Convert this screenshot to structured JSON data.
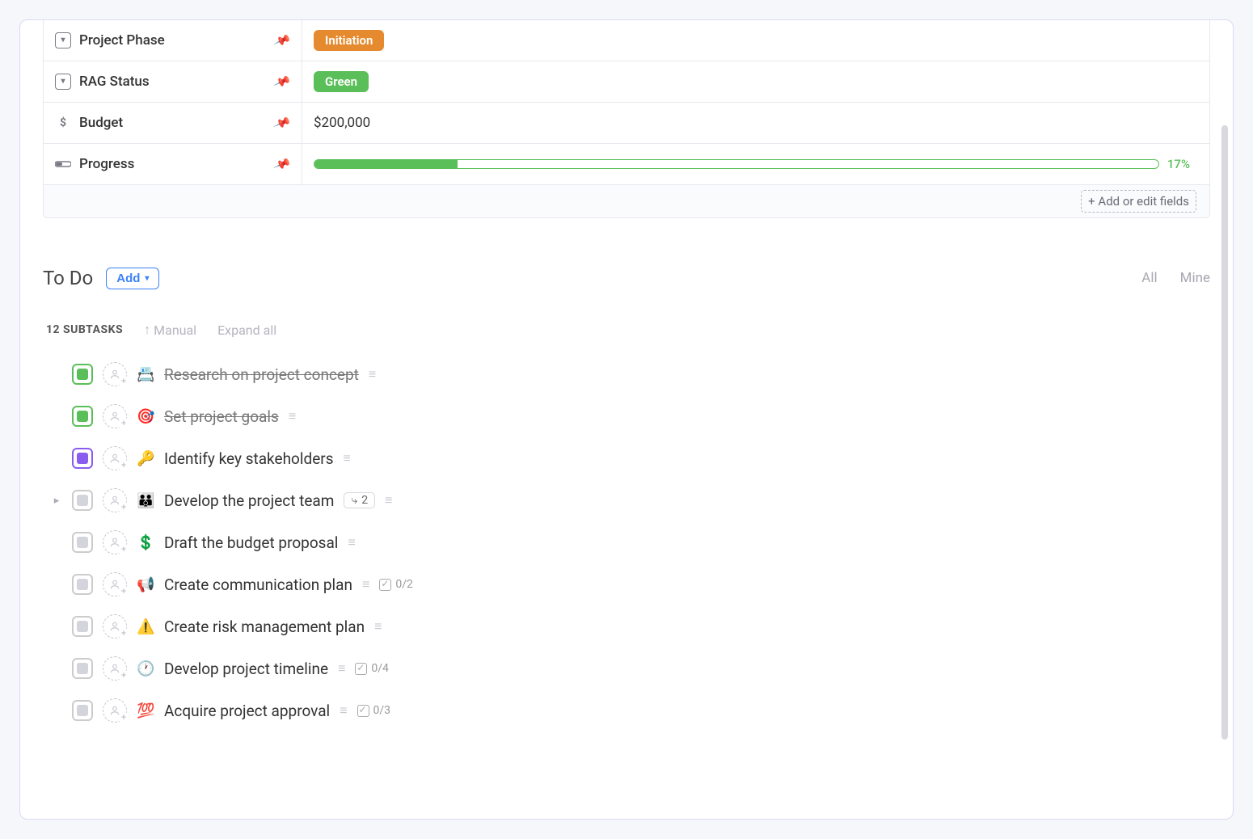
{
  "fields": {
    "phase": {
      "label": "Project Phase",
      "value": "Initiation"
    },
    "rag": {
      "label": "RAG Status",
      "value": "Green"
    },
    "budget": {
      "label": "Budget",
      "value": "$200,000"
    },
    "progress": {
      "label": "Progress",
      "pct": "17%",
      "width": "17%"
    }
  },
  "fields_footer": "+ Add or edit fields",
  "todo": {
    "title": "To Do",
    "add_label": "Add",
    "filter_all": "All",
    "filter_mine": "Mine",
    "subtask_count": "12 SUBTASKS",
    "sort_label": "Manual",
    "expand_label": "Expand all"
  },
  "tasks": [
    {
      "emoji": "📇",
      "title": "Research on project concept",
      "status": "done",
      "done": true
    },
    {
      "emoji": "🎯",
      "title": "Set project goals",
      "status": "done",
      "done": true
    },
    {
      "emoji": "🔑",
      "title": "Identify key stakeholders",
      "status": "purple",
      "done": false
    },
    {
      "emoji": "👪",
      "title": "Develop the project team",
      "status": "grey",
      "done": false,
      "subtasks": "2",
      "expandable": true
    },
    {
      "emoji": "💲",
      "title": "Draft the budget proposal",
      "status": "grey",
      "done": false
    },
    {
      "emoji": "📢",
      "title": "Create communication plan",
      "status": "grey",
      "done": false,
      "checklist": "0/2"
    },
    {
      "emoji": "⚠️",
      "title": "Create risk management plan",
      "status": "grey",
      "done": false
    },
    {
      "emoji": "🕐",
      "title": "Develop project timeline",
      "status": "grey",
      "done": false,
      "checklist": "0/4"
    },
    {
      "emoji": "💯",
      "title": "Acquire project approval",
      "status": "grey",
      "done": false,
      "checklist": "0/3"
    }
  ]
}
